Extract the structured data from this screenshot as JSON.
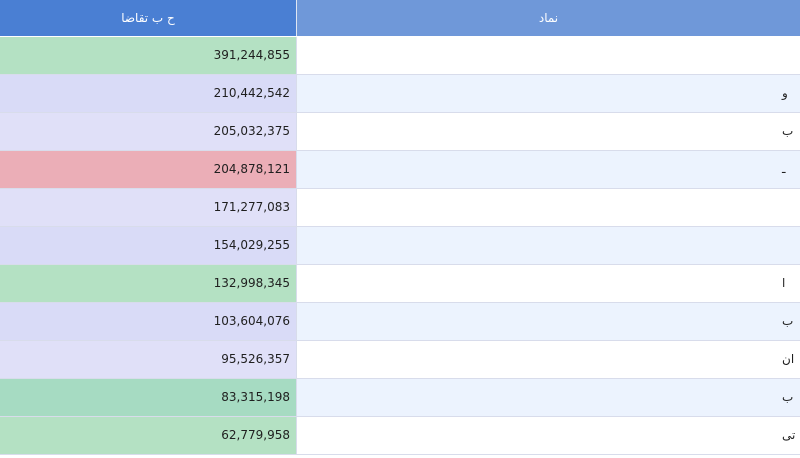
{
  "table": {
    "headers": {
      "demand": "ح ب تقاضا",
      "symbol": "نماد"
    },
    "rows": [
      {
        "value": "391,244,855",
        "symbol": "",
        "value_color": "#b4e1c3"
      },
      {
        "value": "210,442,542",
        "symbol": "و",
        "value_color": "#d9dbf7"
      },
      {
        "value": "205,032,375",
        "symbol": "ب",
        "value_color": "#e0e0f8"
      },
      {
        "value": "204,878,121",
        "symbol": "ـ",
        "value_color": "#ebaeb7"
      },
      {
        "value": "171,277,083",
        "symbol": "",
        "value_color": "#e0e0f8"
      },
      {
        "value": "154,029,255",
        "symbol": "",
        "value_color": "#d9dbf7"
      },
      {
        "value": "132,998,345",
        "symbol": "ا",
        "value_color": "#b4e1c3"
      },
      {
        "value": "103,604,076",
        "symbol": "ب",
        "value_color": "#d9dbf7"
      },
      {
        "value": "95,526,357",
        "symbol": "ان",
        "value_color": "#e0e0f8"
      },
      {
        "value": "83,315,198",
        "symbol": "ب",
        "value_color": "#a6dbc2"
      },
      {
        "value": "62,779,958",
        "symbol": "تی",
        "value_color": "#b4e1c3"
      }
    ]
  }
}
